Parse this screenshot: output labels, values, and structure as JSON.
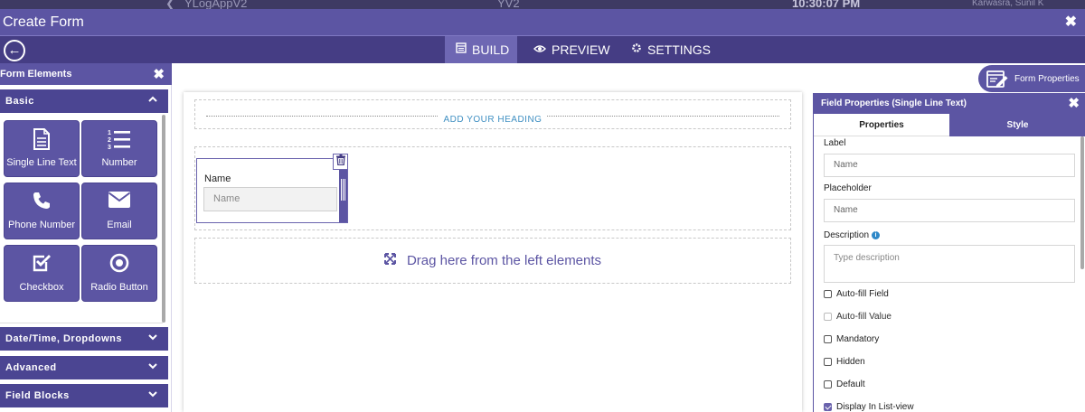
{
  "background_app": {
    "app_name": "YLogAppV2",
    "center_text": "YV2",
    "clock": "10:30:07 PM",
    "user_name": "Karwasra, Sunil K"
  },
  "window": {
    "title": "Create Form",
    "close_label": "✖"
  },
  "nav": {
    "back_label": "←",
    "tabs": [
      {
        "label": "BUILD",
        "icon": "build-icon",
        "active": true
      },
      {
        "label": "PREVIEW",
        "icon": "eye-icon",
        "active": false
      },
      {
        "label": "SETTINGS",
        "icon": "gear-icon",
        "active": false
      }
    ]
  },
  "left_panel": {
    "title": "Form Elements",
    "close_label": "✖",
    "sections": [
      {
        "label": "Basic",
        "expanded": true
      },
      {
        "label": "Date/Time, Dropdowns",
        "expanded": false
      },
      {
        "label": "Advanced",
        "expanded": false
      },
      {
        "label": "Field Blocks",
        "expanded": false
      }
    ],
    "elements": [
      {
        "label": "Single Line Text",
        "icon": "document-icon"
      },
      {
        "label": "Number",
        "icon": "numbered-list-icon"
      },
      {
        "label": "Phone Number",
        "icon": "phone-icon"
      },
      {
        "label": "Email",
        "icon": "envelope-icon"
      },
      {
        "label": "Checkbox",
        "icon": "checkbox-icon"
      },
      {
        "label": "Radio Button",
        "icon": "radio-icon"
      }
    ]
  },
  "canvas": {
    "heading_placeholder": "ADD YOUR HEADING",
    "field": {
      "label": "Name",
      "placeholder": "Name"
    },
    "drop_message": "Drag here from the left elements"
  },
  "form_properties_button": {
    "label": "Form Properties"
  },
  "field_properties": {
    "title": "Field Properties (Single Line Text)",
    "close_label": "✖",
    "tabs": [
      {
        "label": "Properties",
        "active": true
      },
      {
        "label": "Style",
        "active": false
      }
    ],
    "label_title": "Label",
    "label_value": "Name",
    "placeholder_title": "Placeholder",
    "placeholder_value": "Name",
    "description_title": "Description",
    "description_placeholder": "Type description",
    "checkboxes": [
      {
        "label": "Auto-fill Field",
        "checked": false,
        "disabled": false
      },
      {
        "label": "Auto-fill Value",
        "checked": false,
        "disabled": true
      },
      {
        "label": "Mandatory",
        "checked": false,
        "disabled": false
      },
      {
        "label": "Hidden",
        "checked": false,
        "disabled": false
      },
      {
        "label": "Default",
        "checked": false,
        "disabled": false
      },
      {
        "label": "Display In List-view",
        "checked": true,
        "disabled": false
      }
    ]
  },
  "colors": {
    "primary": "#5c55a3",
    "nav": "#453d84",
    "section": "#4b4592",
    "accent_link": "#3f8fc2"
  }
}
